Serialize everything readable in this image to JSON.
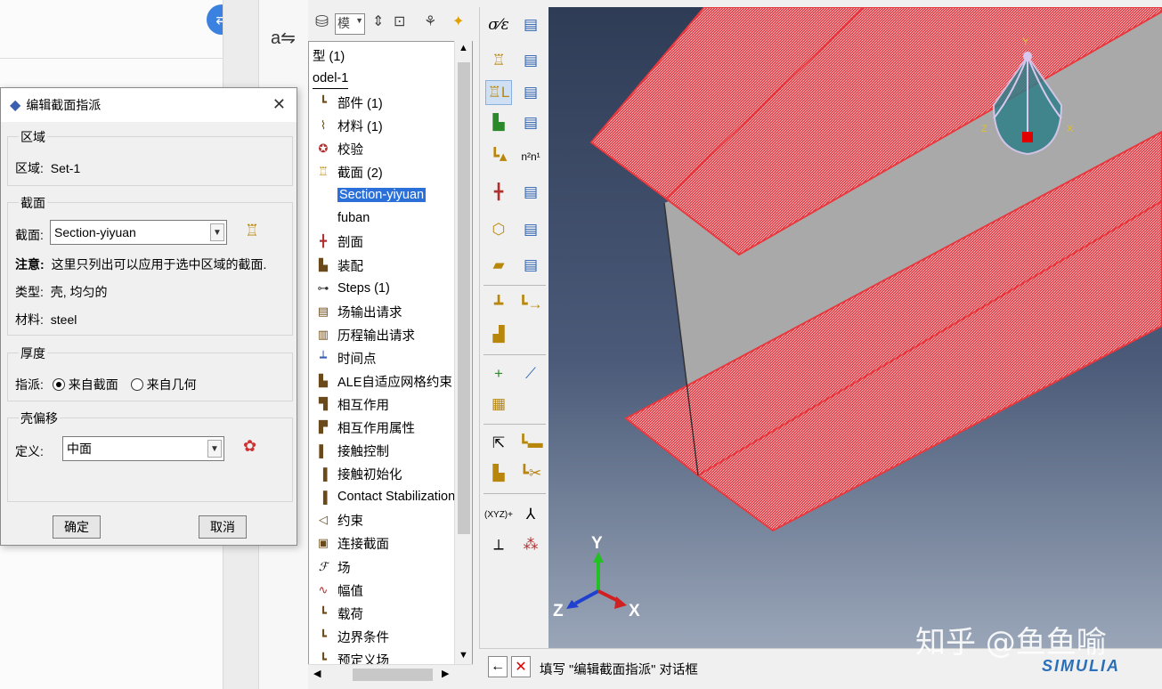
{
  "dialog": {
    "title": "编辑截面指派",
    "region_group": "区域",
    "region_label": "区域:",
    "region_value": "Set-1",
    "section_group": "截面",
    "section_label": "截面:",
    "section_value": "Section-yiyuan",
    "note_label": "注意:",
    "note_text": "这里只列出可以应用于选中区域的截面.",
    "type_label": "类型:",
    "type_value": "壳, 均匀的",
    "material_label": "材料:",
    "material_value": "steel",
    "thickness_group": "厚度",
    "assign_label": "指派:",
    "radio_from_section": "来自截面",
    "radio_from_geometry": "来自几何",
    "offset_group": "壳偏移",
    "define_label": "定义:",
    "define_value": "中面",
    "ok": "确定",
    "cancel": "取消"
  },
  "toolbar": {
    "module_combo": "模"
  },
  "tree": {
    "items": [
      {
        "label": "型 (1)",
        "icon": "none"
      },
      {
        "label": "odel-1",
        "icon": "none"
      },
      {
        "label": "部件 (1)",
        "icon": "part-icon"
      },
      {
        "label": "材料 (1)",
        "icon": "material-icon"
      },
      {
        "label": "校验",
        "icon": "calibration-icon"
      },
      {
        "label": "截面 (2)",
        "icon": "section-icon"
      },
      {
        "label": "Section-yiyuan",
        "icon": "none"
      },
      {
        "label": "fuban",
        "icon": "none"
      },
      {
        "label": "剖面",
        "icon": "profile-icon"
      },
      {
        "label": "装配",
        "icon": "assembly-icon"
      },
      {
        "label": "Steps (1)",
        "icon": "steps-icon"
      },
      {
        "label": "场输出请求",
        "icon": "field-output-icon"
      },
      {
        "label": "历程输出请求",
        "icon": "history-output-icon"
      },
      {
        "label": "时间点",
        "icon": "time-points-icon"
      },
      {
        "label": "ALE自适应网格约束",
        "icon": "ale-icon"
      },
      {
        "label": "相互作用",
        "icon": "interaction-icon"
      },
      {
        "label": "相互作用属性",
        "icon": "interaction-property-icon"
      },
      {
        "label": "接触控制",
        "icon": "contact-control-icon"
      },
      {
        "label": "接触初始化",
        "icon": "contact-init-icon"
      },
      {
        "label": "Contact Stabilization",
        "icon": "contact-stab-icon"
      },
      {
        "label": "约束",
        "icon": "constraint-icon"
      },
      {
        "label": "连接截面",
        "icon": "connector-section-icon"
      },
      {
        "label": "场",
        "icon": "field-icon"
      },
      {
        "label": "幅值",
        "icon": "amplitude-icon"
      },
      {
        "label": "载荷",
        "icon": "load-icon"
      },
      {
        "label": "边界条件",
        "icon": "bc-icon"
      },
      {
        "label": "预定义场",
        "icon": "predefined-field-icon"
      }
    ]
  },
  "viewport": {
    "triad_y": "Y",
    "triad_z": "Z",
    "triad_x": "X",
    "small_y": "Y",
    "small_z": "Z",
    "small_x": "X"
  },
  "prompt": {
    "text": "填写 \"编辑截面指派\" 对话框"
  },
  "watermark": "知乎 @鱼鱼喻",
  "brand": "SIMULIA",
  "colors": {
    "selection": "#2a70d8",
    "flange_red": "#e8393f",
    "web_gray": "#a9a9a9"
  }
}
